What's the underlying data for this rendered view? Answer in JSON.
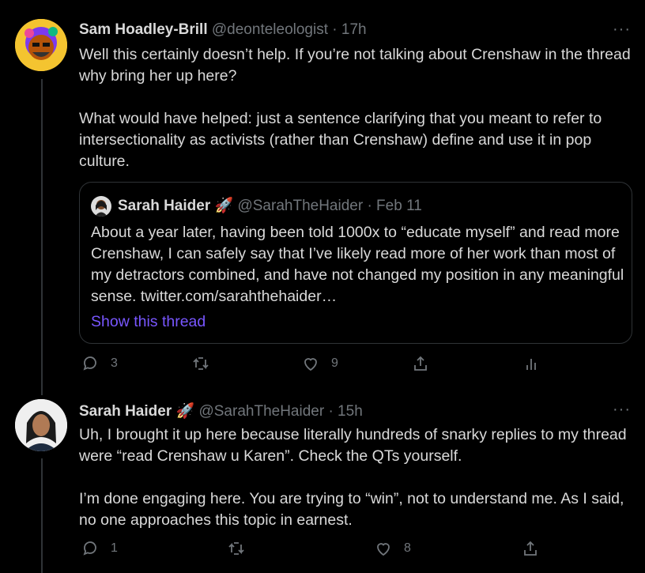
{
  "tweet1": {
    "name": "Sam Hoadley-Brill",
    "handle": "@deonteleologist",
    "time": "· 17h",
    "text": "Well this certainly doesn’t help. If you’re not talking about Crenshaw in the thread why bring her up here?\n\nWhat would have helped: just a sentence clarifying that you meant to refer to intersectionality as activists (rather than Crenshaw) define and use it in pop culture.",
    "more_icon": "···",
    "quote": {
      "name": "Sarah Haider",
      "emoji": "🚀",
      "handle": "@SarahTheHaider",
      "time": "· Feb 11",
      "text": "About a year later, having been told 1000x to “educate myself” and read more Crenshaw, I can safely say that I’ve likely read more of her work than most of my detractors combined, and have not changed my position in any meaningful sense. twitter.com/sarahthehaider…",
      "show_thread": "Show this thread"
    },
    "reply_count": "3",
    "retweet_count": "",
    "like_count": "9"
  },
  "tweet2": {
    "name": "Sarah Haider",
    "emoji": "🚀",
    "handle": "@SarahTheHaider",
    "time": "· 15h",
    "text": "Uh, I brought it up here because literally hundreds of snarky replies to my thread were “read Crenshaw u Karen”. Check the QTs yourself.\n\nI’m done engaging here. You are trying to “win”, not to understand me. As I said, no one approaches this topic in earnest.",
    "more_icon": "···",
    "reply_count": "1",
    "retweet_count": "",
    "like_count": "8"
  },
  "colors": {
    "background": "#000000",
    "text": "#d9d9d9",
    "muted": "#71767b",
    "link": "#7856ff",
    "border": "#2f3336"
  }
}
